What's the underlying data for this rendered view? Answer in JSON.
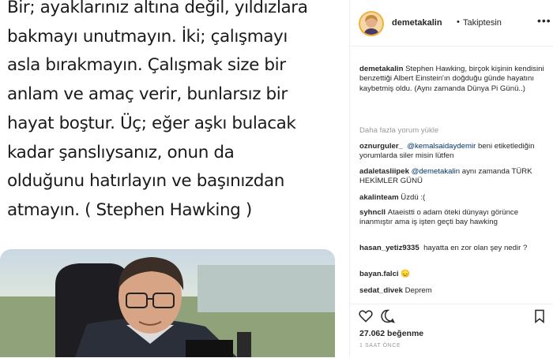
{
  "post": {
    "quote_lines": [
      "Bir; ayaklarınız altına değil, yıldızlara",
      "bakmayı unutmayın. İki; çalışmayı",
      "asla bırakmayın. Çalışmak size bir",
      "anlam ve amaç verir, bunlarsız bir",
      "hayat boştur. Üç; eğer aşkı bulacak",
      "kadar şanslıysanız, onun da",
      "olduğunu hatırlayın ve başınızdan",
      "atmayın. ( Stephen Hawking )"
    ]
  },
  "header": {
    "username": "demetakalin",
    "dot": "•",
    "follow_status": "Takiptesin",
    "more": "•••"
  },
  "caption": {
    "username": "demetakalin",
    "text": " Stephen Hawking, birçok kişinin kendisini benzettiği Albert Einstein'ın doğduğu günde hayatını kaybetmiş oldu. (Aynı zamanda Dünya Pi Günü..)"
  },
  "load_more": "Daha fazla yorum yükle",
  "comments": [
    {
      "username": "oznurguler_",
      "mention": "@kemalsaidaydemir",
      "text": " beni etiketlediğin yorumlarda siler misin lütfen"
    },
    {
      "username": "adaletasliipek",
      "mention": "@demetakalin",
      "text": " aynı zamanda TÜRK HEKİMLER GÜNÜ"
    },
    {
      "username": "akalinteam",
      "mention": "",
      "text": "Üzdü :("
    },
    {
      "username": "syhncll",
      "mention": "",
      "text": "Ataeistti o adam öteki dünyayı görünce inanmıştır ama iş işten geçti bay hawking"
    },
    {
      "username": "hasan_yetiz9335",
      "mention": "",
      "text": "hayatta en zor olan şey nedir ?"
    },
    {
      "username": "bayan.falci",
      "mention": "",
      "text": "😞"
    },
    {
      "username": "sedat_divek",
      "mention": "",
      "text": "Deprem"
    }
  ],
  "likes": "27.062 beğenme",
  "timestamp": "1 SAAT ÖNCE",
  "colors": {
    "accent_link": "#003569",
    "muted": "#999999",
    "border": "#efefef",
    "avatar_ring": "#f0b23d"
  }
}
